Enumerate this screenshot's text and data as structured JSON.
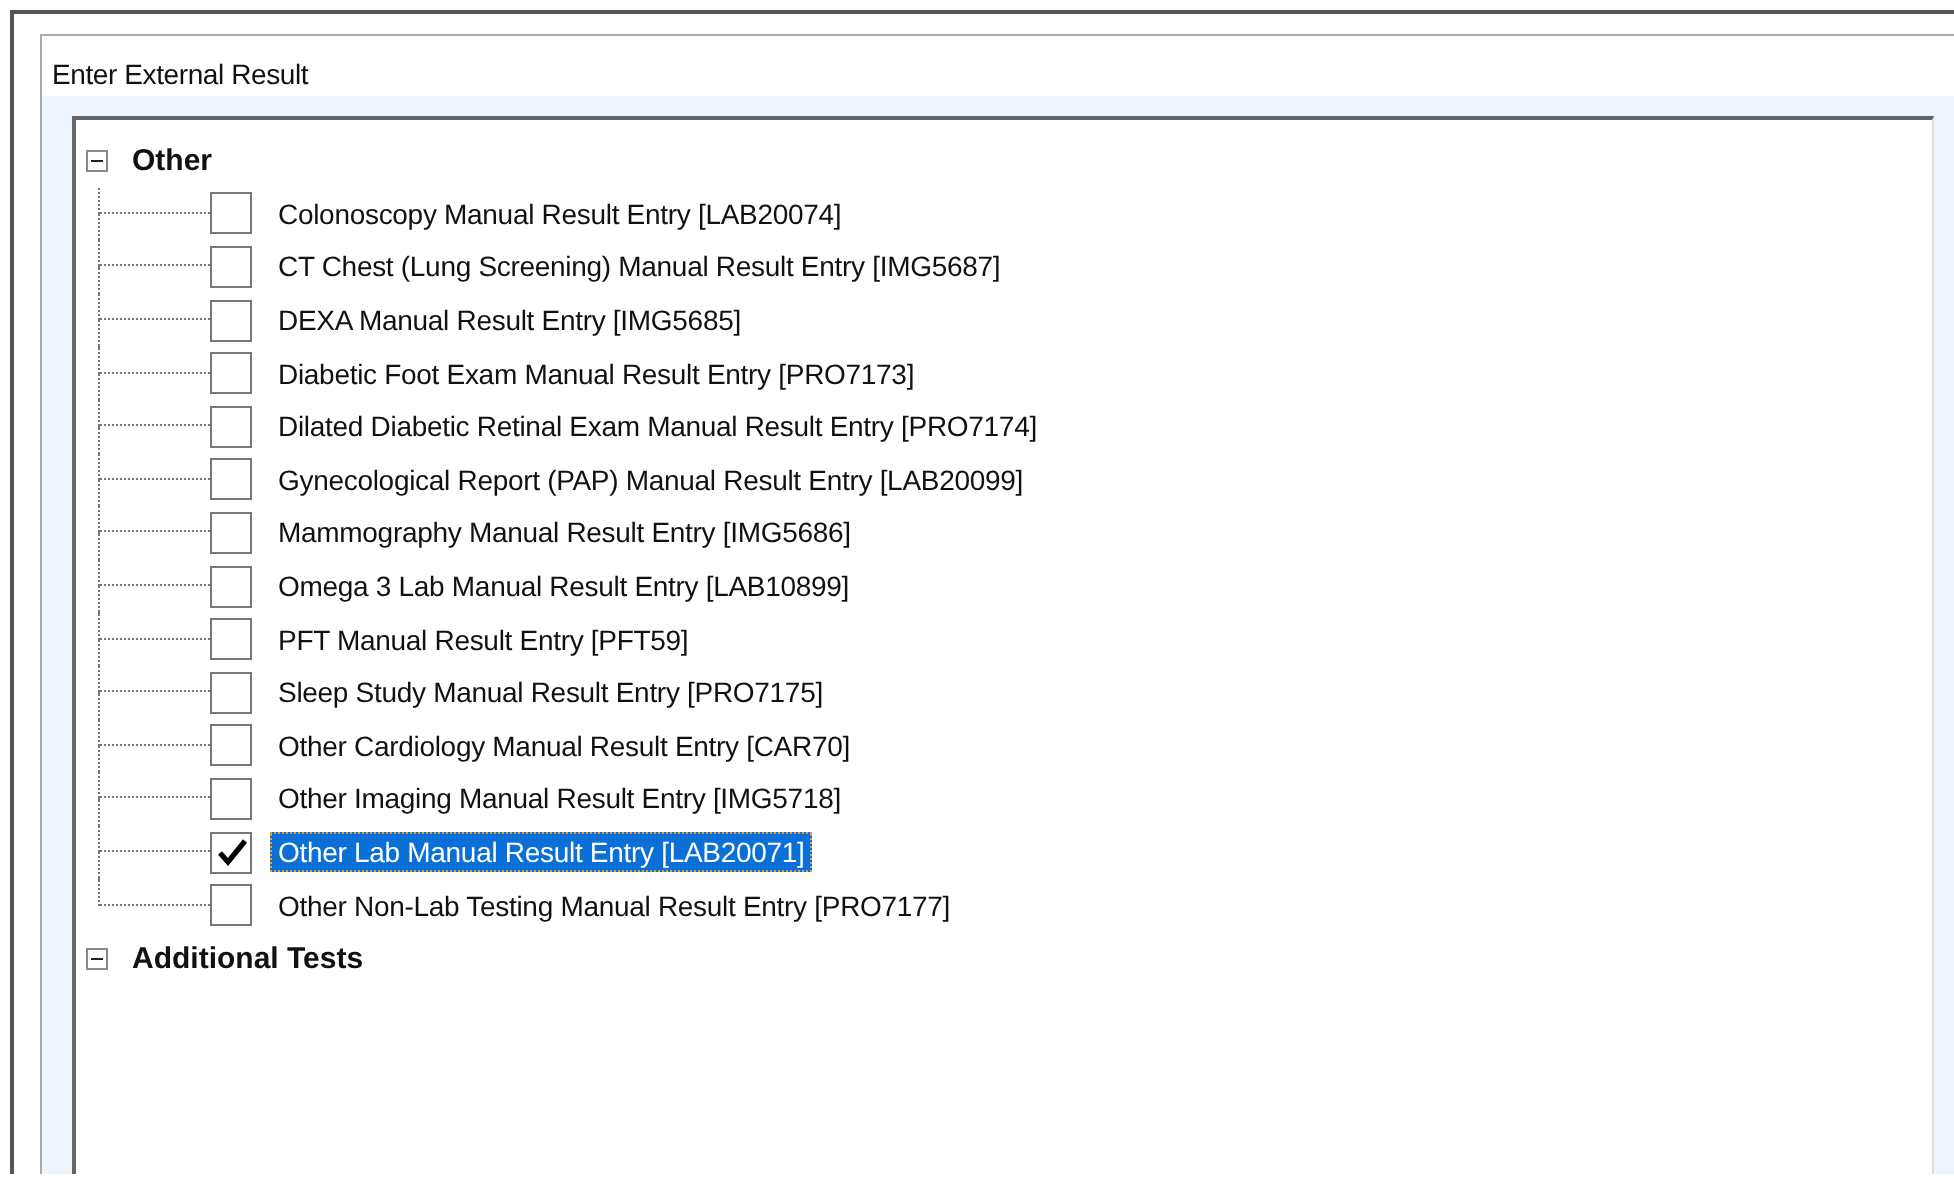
{
  "panel": {
    "title": "Enter External Result"
  },
  "tree": [
    {
      "label": "Other",
      "expanded": true,
      "children": [
        {
          "label": "Colonoscopy Manual Result Entry [LAB20074]",
          "checked": false,
          "selected": false
        },
        {
          "label": "CT Chest (Lung Screening) Manual Result Entry [IMG5687]",
          "checked": false,
          "selected": false
        },
        {
          "label": "DEXA Manual Result Entry [IMG5685]",
          "checked": false,
          "selected": false
        },
        {
          "label": "Diabetic Foot Exam Manual Result Entry [PRO7173]",
          "checked": false,
          "selected": false
        },
        {
          "label": "Dilated Diabetic Retinal Exam Manual Result Entry [PRO7174]",
          "checked": false,
          "selected": false
        },
        {
          "label": "Gynecological Report (PAP) Manual Result Entry [LAB20099]",
          "checked": false,
          "selected": false
        },
        {
          "label": "Mammography Manual Result Entry [IMG5686]",
          "checked": false,
          "selected": false
        },
        {
          "label": "Omega 3 Lab Manual Result Entry [LAB10899]",
          "checked": false,
          "selected": false
        },
        {
          "label": "PFT Manual Result Entry [PFT59]",
          "checked": false,
          "selected": false
        },
        {
          "label": "Sleep Study Manual Result Entry [PRO7175]",
          "checked": false,
          "selected": false
        },
        {
          "label": "Other Cardiology Manual Result Entry [CAR70]",
          "checked": false,
          "selected": false
        },
        {
          "label": "Other Imaging Manual Result Entry [IMG5718]",
          "checked": false,
          "selected": false
        },
        {
          "label": "Other Lab Manual Result Entry [LAB20071]",
          "checked": true,
          "selected": true
        },
        {
          "label": "Other Non-Lab Testing Manual Result Entry [PRO7177]",
          "checked": false,
          "selected": false
        }
      ]
    },
    {
      "label": "Additional Tests",
      "expanded": true
    }
  ]
}
